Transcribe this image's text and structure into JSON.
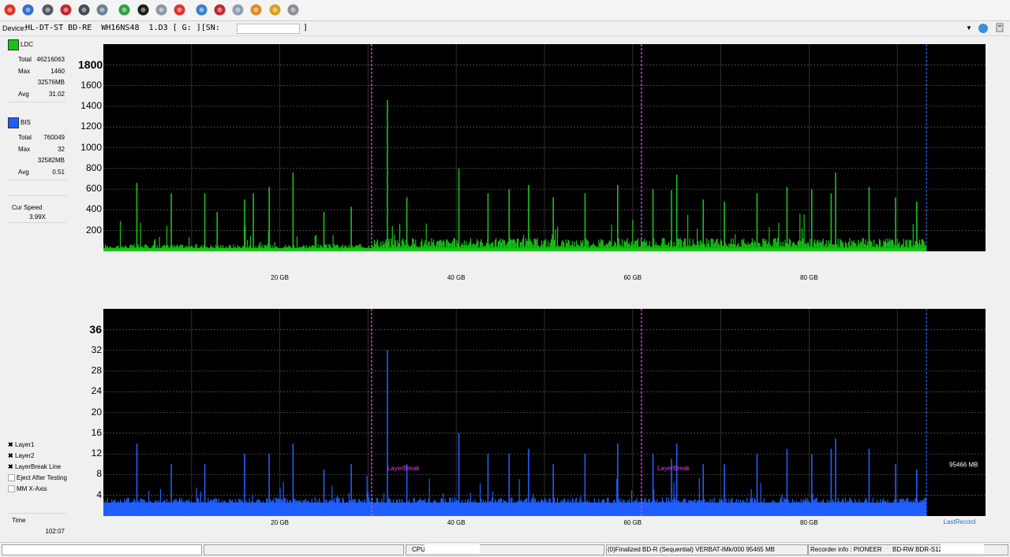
{
  "toolbar": {
    "buttons": [
      {
        "name": "power-icon",
        "color": "#d9352c"
      },
      {
        "name": "drive-info-icon",
        "color": "#2f6fd0"
      },
      {
        "name": "disc-read-icon",
        "color": "#555a66"
      },
      {
        "name": "disc-erase-icon",
        "color": "#c0282f"
      },
      {
        "name": "disc-write-icon",
        "color": "#444b55"
      },
      {
        "name": "disc-copy-icon",
        "color": "#6d7f99"
      },
      {
        "name": "refresh-icon",
        "color": "#2ea043"
      },
      {
        "name": "record-icon",
        "color": "#1d1d1d"
      },
      {
        "name": "check-icon",
        "color": "#8a98a8"
      },
      {
        "name": "stop-icon",
        "color": "#d9352c"
      },
      {
        "name": "disc-blue-icon",
        "color": "#3b7fcc"
      },
      {
        "name": "disc-red-icon",
        "color": "#c0282f"
      },
      {
        "name": "disc-scan-icon",
        "color": "#8aa0b4"
      },
      {
        "name": "burn-icon",
        "color": "#e08a2c"
      },
      {
        "name": "chart-icon",
        "color": "#d6a21f"
      },
      {
        "name": "printer-icon",
        "color": "#8a8f96"
      }
    ]
  },
  "device": {
    "label": "Device:",
    "text": "HL-DT-ST BD-RE  WH16NS48  1.D3 [ G: ][SN:",
    "sn_close": "]"
  },
  "ldc": {
    "name": "LDC",
    "color": "#17c417",
    "total_label": "Total",
    "total": "46216063",
    "max_label": "Max",
    "max": "1460",
    "max_pos": "32576MB",
    "avg_label": "Avg",
    "avg": "31.02"
  },
  "bis": {
    "name": "BIS",
    "color": "#1f5eff",
    "total_label": "Total",
    "total": "760049",
    "max_label": "Max",
    "max": "32",
    "max_pos": "32582MB",
    "avg_label": "Avg",
    "avg": "0.51"
  },
  "speed": {
    "label": "Cur Speed",
    "value": "3.99X"
  },
  "options": [
    {
      "label": "Layer1",
      "checked": true
    },
    {
      "label": "Layer2",
      "checked": true
    },
    {
      "label": "LayerBreak Line",
      "checked": true
    },
    {
      "label": "Eject After Testing",
      "checked": false
    },
    {
      "label": "MM X-Axis",
      "checked": false
    }
  ],
  "time": {
    "label": "Time",
    "value": "102:07"
  },
  "chart_data": [
    {
      "type": "bar",
      "name": "LDC",
      "x_unit": "GB",
      "xlim": [
        0,
        100
      ],
      "ylim": [
        0,
        2000
      ],
      "yticks": [
        "200",
        "400",
        "600",
        "800",
        "1000",
        "1200",
        "1400",
        "1600",
        "1800"
      ],
      "ytick_values": [
        200,
        400,
        600,
        800,
        1000,
        1200,
        1400,
        1600,
        1800
      ],
      "xticks": [
        "20 GB",
        "40 GB",
        "60 GB",
        "80 GB"
      ],
      "xtick_values": [
        20,
        40,
        60,
        80
      ],
      "grid": true,
      "color": "#17c417",
      "data_end_gb": 93.3,
      "layer_breaks_gb": [
        30.4,
        61.0
      ],
      "end_marker_gb": 93.3,
      "peaks": [
        {
          "x": 3.8,
          "y": 660
        },
        {
          "x": 7.7,
          "y": 560
        },
        {
          "x": 11.5,
          "y": 560
        },
        {
          "x": 12.9,
          "y": 380
        },
        {
          "x": 16.0,
          "y": 500
        },
        {
          "x": 17.0,
          "y": 560
        },
        {
          "x": 18.8,
          "y": 620
        },
        {
          "x": 21.5,
          "y": 760
        },
        {
          "x": 25.0,
          "y": 380
        },
        {
          "x": 28.1,
          "y": 430
        },
        {
          "x": 32.2,
          "y": 1460
        },
        {
          "x": 34.4,
          "y": 520
        },
        {
          "x": 40.3,
          "y": 800
        },
        {
          "x": 43.6,
          "y": 560
        },
        {
          "x": 46.0,
          "y": 600
        },
        {
          "x": 48.2,
          "y": 640
        },
        {
          "x": 51.0,
          "y": 520
        },
        {
          "x": 54.6,
          "y": 560
        },
        {
          "x": 58.3,
          "y": 640
        },
        {
          "x": 62.3,
          "y": 600
        },
        {
          "x": 64.4,
          "y": 590
        },
        {
          "x": 65.0,
          "y": 740
        },
        {
          "x": 68.0,
          "y": 500
        },
        {
          "x": 70.4,
          "y": 480
        },
        {
          "x": 74.1,
          "y": 560
        },
        {
          "x": 77.5,
          "y": 620
        },
        {
          "x": 80.3,
          "y": 600
        },
        {
          "x": 82.5,
          "y": 560
        },
        {
          "x": 83.0,
          "y": 760
        },
        {
          "x": 86.8,
          "y": 620
        },
        {
          "x": 89.8,
          "y": 520
        },
        {
          "x": 92.2,
          "y": 480
        }
      ]
    },
    {
      "type": "bar",
      "name": "BIS",
      "x_unit": "GB",
      "xlim": [
        0,
        100
      ],
      "ylim": [
        0,
        40
      ],
      "yticks": [
        "4",
        "8",
        "12",
        "16",
        "20",
        "24",
        "28",
        "32",
        "36"
      ],
      "ytick_values": [
        4,
        8,
        12,
        16,
        20,
        24,
        28,
        32,
        36
      ],
      "xticks": [
        "20 GB",
        "40 GB",
        "60 GB",
        "80 GB"
      ],
      "xtick_values": [
        20,
        40,
        60,
        80
      ],
      "grid": true,
      "color": "#1f5eff",
      "data_end_gb": 93.3,
      "layer_breaks_gb": [
        30.4,
        61.0
      ],
      "end_marker_gb": 93.3,
      "layerbreak_label": "LayerBreak",
      "end_label": "95466 MB",
      "last_label": "LastRecord",
      "peaks": [
        {
          "x": 3.8,
          "y": 14
        },
        {
          "x": 7.7,
          "y": 10
        },
        {
          "x": 11.5,
          "y": 10
        },
        {
          "x": 16.0,
          "y": 12
        },
        {
          "x": 18.8,
          "y": 12
        },
        {
          "x": 21.5,
          "y": 14
        },
        {
          "x": 25.0,
          "y": 9
        },
        {
          "x": 28.1,
          "y": 10
        },
        {
          "x": 32.2,
          "y": 32
        },
        {
          "x": 34.4,
          "y": 10
        },
        {
          "x": 40.3,
          "y": 16
        },
        {
          "x": 43.6,
          "y": 12
        },
        {
          "x": 46.0,
          "y": 12
        },
        {
          "x": 48.2,
          "y": 13
        },
        {
          "x": 51.0,
          "y": 10
        },
        {
          "x": 54.6,
          "y": 12
        },
        {
          "x": 58.3,
          "y": 14
        },
        {
          "x": 62.3,
          "y": 12
        },
        {
          "x": 64.4,
          "y": 11
        },
        {
          "x": 65.0,
          "y": 14
        },
        {
          "x": 68.0,
          "y": 10
        },
        {
          "x": 70.4,
          "y": 10
        },
        {
          "x": 74.1,
          "y": 12
        },
        {
          "x": 77.5,
          "y": 13
        },
        {
          "x": 80.3,
          "y": 12
        },
        {
          "x": 82.5,
          "y": 13
        },
        {
          "x": 83.0,
          "y": 15
        },
        {
          "x": 86.8,
          "y": 13
        },
        {
          "x": 89.8,
          "y": 10
        },
        {
          "x": 92.2,
          "y": 9
        }
      ]
    }
  ],
  "status": {
    "cpu_label": "CPU:",
    "disc_info": "(0)Finalized  BD-R (Sequential)  VERBAT-IMk/000  95465 MB",
    "recorder_label": "Recorder info : PIONEER",
    "recorder_model": "BD-RW   BDR-S12"
  }
}
